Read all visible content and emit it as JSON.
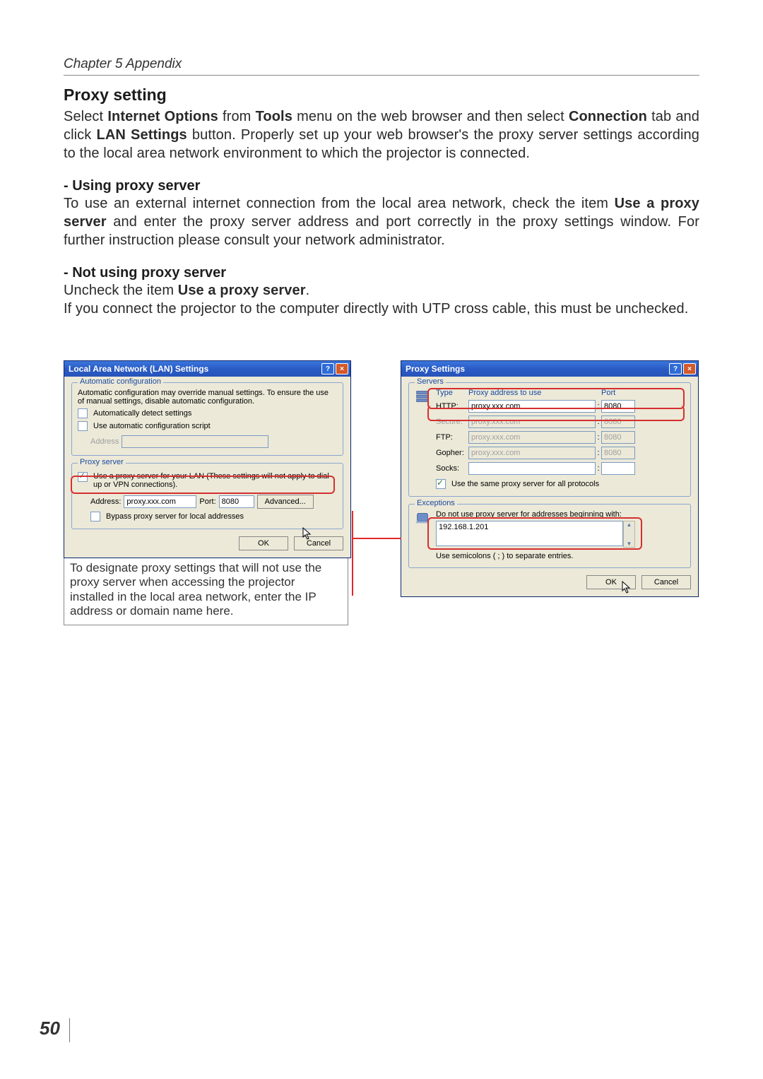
{
  "chapter": {
    "title": "Chapter 5 Appendix",
    "page_number": "50"
  },
  "section": {
    "title": "Proxy setting",
    "intro_parts": [
      "Select ",
      "Internet Options",
      " from ",
      "Tools",
      " menu on the web browser and then select ",
      "Connection",
      " tab and click ",
      "LAN Settings",
      " button. Properly set up your web browser's the proxy server settings according to the local area network environment to which the projector is connected."
    ],
    "using_title": "- Using proxy server",
    "using_parts": [
      "To use an external internet connection from the local area network, check the item ",
      "Use a proxy server",
      " and enter the proxy server address and port correctly in the proxy settings window. For further instruction please consult your network administrator."
    ],
    "notusing_title": "- Not using proxy server",
    "notusing_line1_parts": [
      "Uncheck the item ",
      "Use a proxy server",
      "."
    ],
    "notusing_text": "If you connect the projector to the computer directly with UTP cross cable, this must be unchecked."
  },
  "lan_dialog": {
    "title": "Local Area Network (LAN) Settings",
    "autoconf": {
      "legend": "Automatic configuration",
      "desc": "Automatic configuration may override manual settings.  To ensure the use of manual settings, disable automatic configuration.",
      "chk_detect": "Automatically detect settings",
      "chk_script": "Use automatic configuration script",
      "addr_label": "Address"
    },
    "proxy": {
      "legend": "Proxy server",
      "chk_use": "Use a proxy server for your LAN (These settings will not apply to dial-up or VPN connections).",
      "addr_label": "Address:",
      "addr_value": "proxy.xxx.com",
      "port_label": "Port:",
      "port_value": "8080",
      "advanced": "Advanced...",
      "chk_bypass": "Bypass proxy server for local addresses"
    },
    "ok": "OK",
    "cancel": "Cancel",
    "footnote": "To designate proxy settings that will not use the proxy server when accessing the projector installed in the local area network, enter the IP address or domain name here."
  },
  "proxy_dialog": {
    "title": "Proxy Settings",
    "servers": {
      "legend": "Servers",
      "head_type": "Type",
      "head_addr": "Proxy address to use",
      "head_port": "Port",
      "rows": [
        {
          "label": "HTTP:",
          "addr": "proxy.xxx.com",
          "port": "8080",
          "enabled": true
        },
        {
          "label": "Secure:",
          "addr": "proxy.xxx.com",
          "port": "8080",
          "enabled": false
        },
        {
          "label": "FTP:",
          "addr": "proxy.xxx.com",
          "port": "8080",
          "enabled": false
        },
        {
          "label": "Gopher:",
          "addr": "proxy.xxx.com",
          "port": "8080",
          "enabled": false
        },
        {
          "label": "Socks:",
          "addr": "",
          "port": "",
          "enabled": true
        }
      ],
      "same_all": "Use the same proxy server for all protocols"
    },
    "exceptions": {
      "legend": "Exceptions",
      "desc": "Do not use proxy server for addresses beginning with:",
      "value": "192.168.1.201",
      "hint": "Use semicolons ( ; ) to separate entries."
    },
    "ok": "OK",
    "cancel": "Cancel"
  }
}
